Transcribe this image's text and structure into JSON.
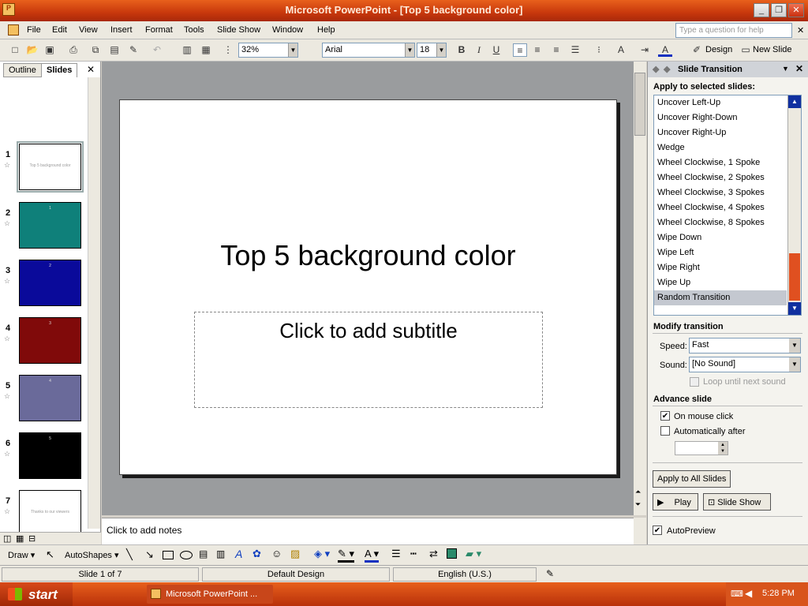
{
  "window": {
    "title": "Microsoft PowerPoint - [Top 5 background color]"
  },
  "menubar": {
    "items": [
      "File",
      "Edit",
      "View",
      "Insert",
      "Format",
      "Tools",
      "Slide Show",
      "Window",
      "Help"
    ],
    "help_placeholder": "Type a question for help"
  },
  "toolbar": {
    "zoom": "32%",
    "font": "Arial",
    "font_size": "18",
    "bold": "B",
    "italic": "I",
    "underline": "U",
    "design_label": "Design",
    "new_slide_label": "New Slide"
  },
  "left_panel": {
    "tabs": [
      "Outline",
      "Slides"
    ],
    "slides": [
      {
        "num": "1",
        "color": "#ffffff",
        "text": "Top 5 background color"
      },
      {
        "num": "2",
        "color": "#0f807a",
        "text": "1"
      },
      {
        "num": "3",
        "color": "#0a0a9a",
        "text": "2"
      },
      {
        "num": "4",
        "color": "#800a0a",
        "text": "3"
      },
      {
        "num": "5",
        "color": "#6a6a9a",
        "text": "4"
      },
      {
        "num": "6",
        "color": "#000000",
        "text": "5"
      },
      {
        "num": "7",
        "color": "#ffffff",
        "text": "Thanks to our viewers"
      }
    ]
  },
  "slide": {
    "title": "Top 5 background color",
    "subtitle": "Click to add subtitle"
  },
  "notes": {
    "placeholder": "Click to add notes"
  },
  "task_pane": {
    "title": "Slide Transition",
    "apply_label": "Apply to selected slides:",
    "transitions": [
      "Uncover Left-Up",
      "Uncover Right-Down",
      "Uncover Right-Up",
      "Wedge",
      "Wheel Clockwise, 1 Spoke",
      "Wheel Clockwise, 2 Spokes",
      "Wheel Clockwise, 3 Spokes",
      "Wheel Clockwise, 4 Spokes",
      "Wheel Clockwise, 8 Spokes",
      "Wipe Down",
      "Wipe Left",
      "Wipe Right",
      "Wipe Up",
      "Random Transition"
    ],
    "selected_transition": "Random Transition",
    "modify_label": "Modify transition",
    "speed_label": "Speed:",
    "speed_value": "Fast",
    "sound_label": "Sound:",
    "sound_value": "[No Sound]",
    "loop_label": "Loop until next sound",
    "advance_label": "Advance slide",
    "on_click_label": "On mouse click",
    "auto_label": "Automatically after",
    "apply_all_label": "Apply to All Slides",
    "play_label": "Play",
    "slideshow_label": "Slide Show",
    "autopreview_label": "AutoPreview"
  },
  "drawbar": {
    "draw_label": "Draw",
    "autoshapes_label": "AutoShapes"
  },
  "status": {
    "slide_pos": "Slide 1 of 7",
    "design": "Default Design",
    "language": "English (U.S.)"
  },
  "taskbar": {
    "start": "start",
    "app": "Microsoft PowerPoint ...",
    "time": "5:28 PM"
  }
}
